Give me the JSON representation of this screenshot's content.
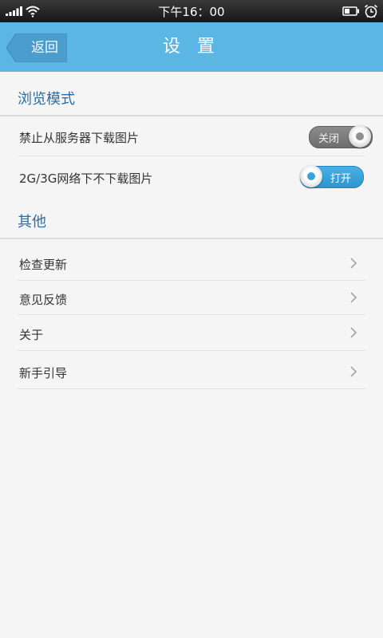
{
  "status_bar": {
    "time": "下午16：00",
    "icons": [
      "signal-icon",
      "wifi-icon",
      "battery-icon",
      "alarm-icon"
    ]
  },
  "header": {
    "back_label": "返回",
    "title": "设 置",
    "background_color": "#5bb6e4"
  },
  "sections": {
    "browse": {
      "title": "浏览模式",
      "items": [
        {
          "label": "禁止从服务器下载图片",
          "toggle_state": "off",
          "toggle_text": "关闭"
        },
        {
          "label": "2G/3G网络下不下载图片",
          "toggle_state": "on",
          "toggle_text": "打开"
        }
      ]
    },
    "other": {
      "title": "其他",
      "items": [
        {
          "label": "检查更新",
          "icon": "chevron-right-icon"
        },
        {
          "label": "意见反馈",
          "icon": "chevron-right-icon"
        },
        {
          "label": "关于",
          "icon": "chevron-right-icon"
        },
        {
          "label": "新手引导",
          "icon": "chevron-right-icon"
        }
      ]
    }
  },
  "colors": {
    "section_title": "#2c6ca3",
    "toggle_on": "#3aa3da",
    "toggle_off": "#7a7a7a"
  }
}
